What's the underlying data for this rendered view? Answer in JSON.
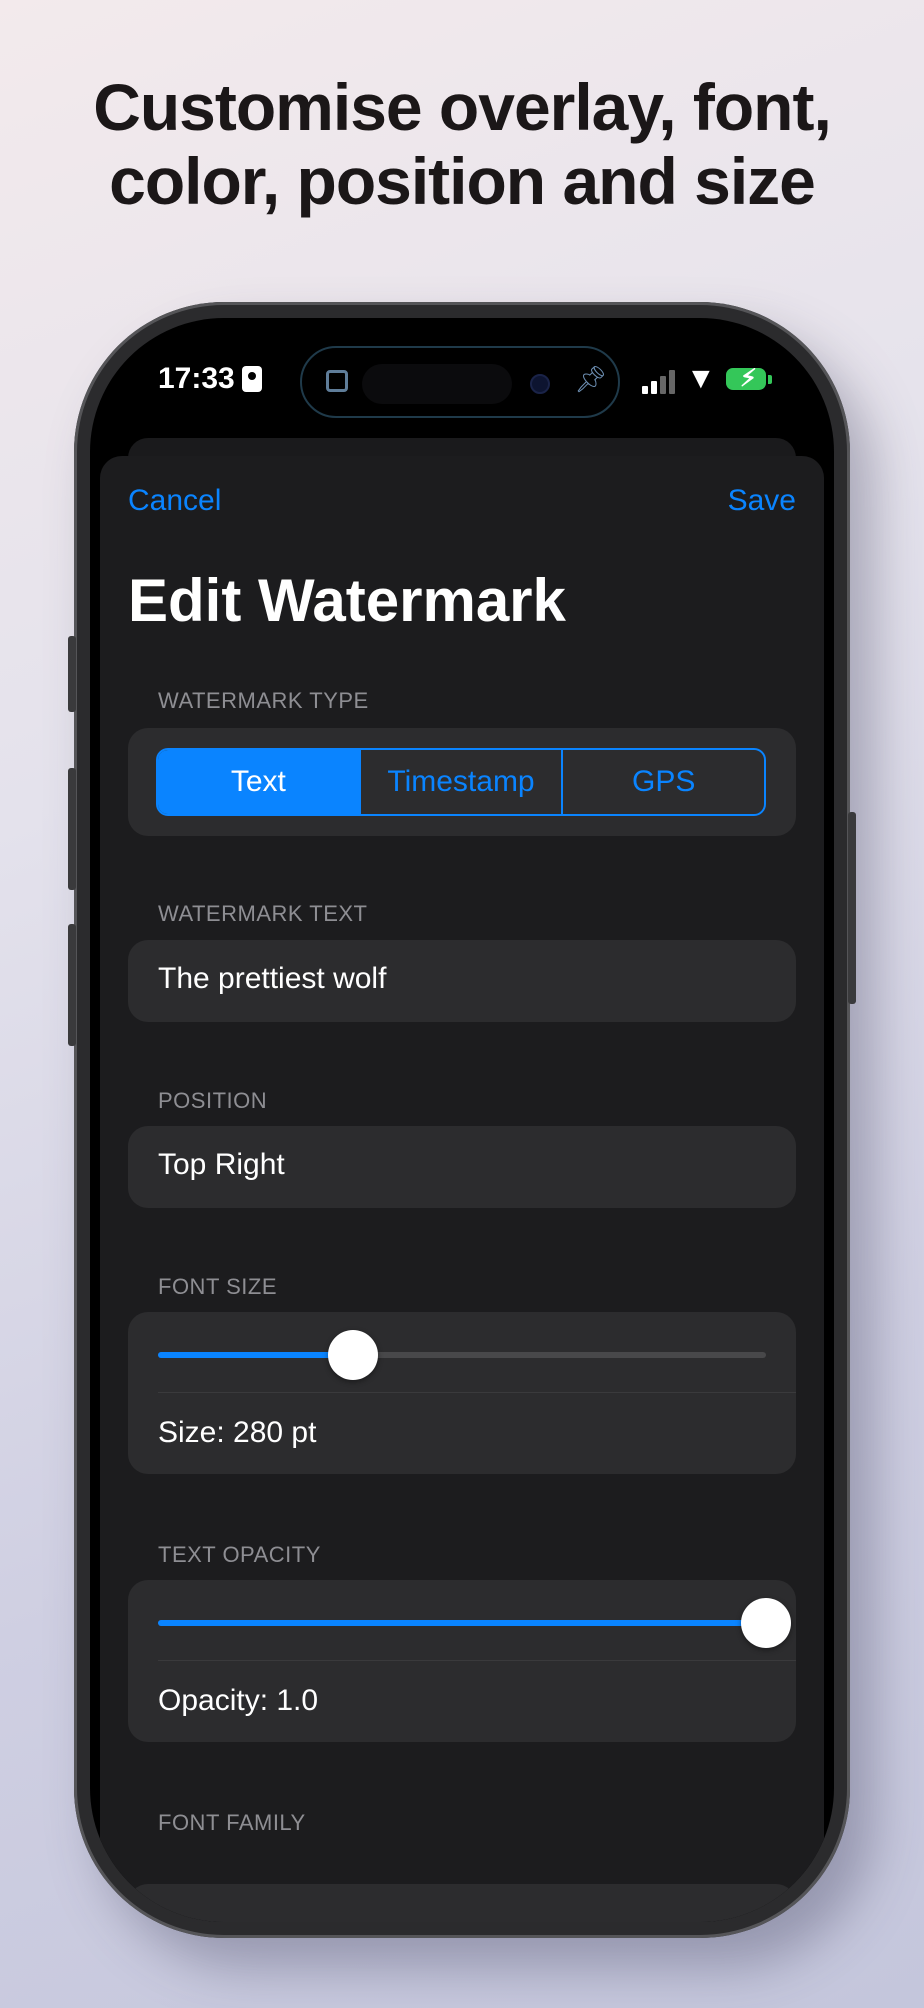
{
  "headline": {
    "line1": "Customise overlay, font,",
    "line2": "color, position and size"
  },
  "status_bar": {
    "time": "17:33",
    "icons": [
      "contact-card-icon",
      "screen-mirror-icon",
      "pin-icon",
      "cellular-signal-icon",
      "wifi-icon",
      "battery-charging-icon"
    ],
    "battery_color": "#34c759"
  },
  "nav": {
    "cancel_label": "Cancel",
    "save_label": "Save",
    "title": "Edit Watermark"
  },
  "watermark_type": {
    "label": "WATERMARK TYPE",
    "options": [
      "Text",
      "Timestamp",
      "GPS"
    ],
    "selected": "Text"
  },
  "watermark_text": {
    "label": "WATERMARK TEXT",
    "value": "The prettiest wolf"
  },
  "position": {
    "label": "POSITION",
    "value": "Top Right"
  },
  "font_size": {
    "label": "FONT SIZE",
    "slider_fraction": 0.32,
    "value_text": "Size: 280 pt"
  },
  "text_opacity": {
    "label": "TEXT OPACITY",
    "slider_fraction": 1.0,
    "value_text": "Opacity: 1.0"
  },
  "font_family": {
    "label": "FONT FAMILY"
  },
  "colors": {
    "accent": "#0a84ff",
    "background": "#1c1c1e",
    "cell": "#2c2c2e"
  }
}
